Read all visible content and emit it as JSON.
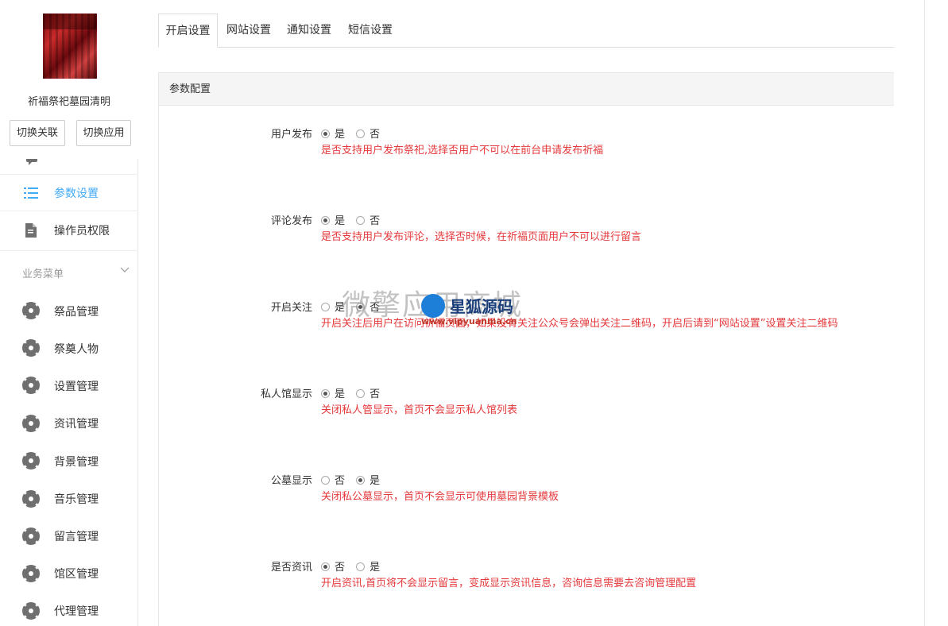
{
  "app": {
    "name": "祈福祭祀墓园清明",
    "switch_assoc": "切换关联",
    "switch_app": "切换应用"
  },
  "sidebar": {
    "items": [
      {
        "label": "参数设置",
        "icon": "list-icon",
        "active": true
      },
      {
        "label": "操作员权限",
        "icon": "document-icon",
        "active": false
      }
    ],
    "group_title": "业务菜单",
    "menu": [
      {
        "label": "祭品管理"
      },
      {
        "label": "祭奠人物"
      },
      {
        "label": "设置管理"
      },
      {
        "label": "资讯管理"
      },
      {
        "label": "背景管理"
      },
      {
        "label": "音乐管理"
      },
      {
        "label": "留言管理"
      },
      {
        "label": "馆区管理"
      },
      {
        "label": "代理管理"
      }
    ]
  },
  "tabs": [
    "开启设置",
    "网站设置",
    "通知设置",
    "短信设置"
  ],
  "panel": {
    "title": "参数配置",
    "rows": [
      {
        "label": "用户发布",
        "options": [
          "是",
          "否"
        ],
        "selected": 0,
        "help": "是否支持用户发布祭祀,选择否用户不可以在前台申请发布祈福"
      },
      {
        "label": "评论发布",
        "options": [
          "是",
          "否"
        ],
        "selected": 0,
        "help": "是否支持用户发布评论，选择否时候，在祈福页面用户不可以进行留言"
      },
      {
        "label": "开启关注",
        "options": [
          "是",
          "否"
        ],
        "selected": 1,
        "help": "开启关注后用户在访问祈福页面，如果没有关注公众号会弹出关注二维码，开启后请到“网站设置”设置关注二维码"
      },
      {
        "label": "私人馆显示",
        "options": [
          "是",
          "否"
        ],
        "selected": 0,
        "help": "关闭私人管显示，首页不会显示私人馆列表"
      },
      {
        "label": "公墓显示",
        "options": [
          "否",
          "是"
        ],
        "selected": 1,
        "help": "关闭私公墓显示，首页不会显示可使用墓园背景模板"
      },
      {
        "label": "是否资讯",
        "options": [
          "否",
          "是"
        ],
        "selected": 0,
        "help": "开启资讯,首页将不会显示留言，变成显示资讯信息，咨询信息需要去咨询管理配置"
      }
    ]
  },
  "watermark": {
    "text": "微擎应用商城",
    "brand": "星狐源码",
    "url": "www.vipyuanma.cn"
  },
  "colors": {
    "accent": "#44abf7",
    "help_text": "#e4393c"
  }
}
